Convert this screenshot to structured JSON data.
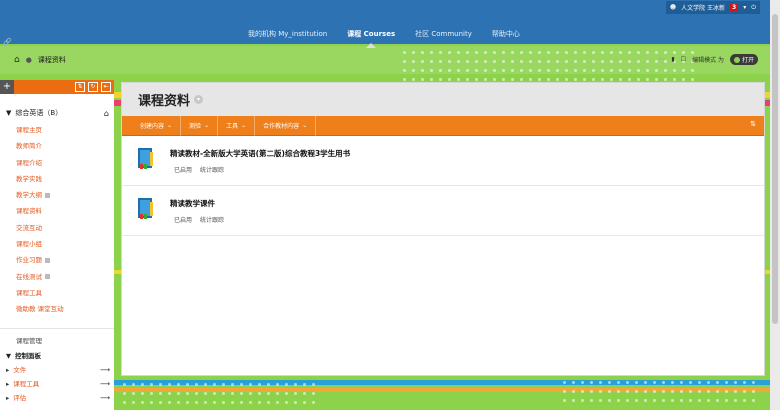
{
  "header": {
    "user_name": "人文学院 王冰新",
    "notification_count": "3",
    "nav": [
      {
        "label": "我的机构 My_institution"
      },
      {
        "label": "课程 Courses"
      },
      {
        "label": "社区 Community"
      },
      {
        "label": "帮助中心"
      }
    ]
  },
  "breadcrumb": {
    "current": "课程资料"
  },
  "edit_mode": {
    "label": "编辑模式 为",
    "state": "打开"
  },
  "sidebar": {
    "course_name": "综合英语（B）",
    "items": [
      {
        "label": "课程主页"
      },
      {
        "label": "教师简介"
      },
      {
        "label": "课程介绍"
      },
      {
        "label": "教学实践"
      },
      {
        "label": "教学大纲"
      },
      {
        "label": "课程资料"
      },
      {
        "label": "交流互动"
      },
      {
        "label": "课程小组"
      },
      {
        "label": "作业习题"
      },
      {
        "label": "在线测试"
      },
      {
        "label": "课程工具"
      },
      {
        "label": "微助教 课堂互动"
      }
    ],
    "management_title": "课程管理",
    "control_panel": "控制面板",
    "panel_items": [
      {
        "label": "文件"
      },
      {
        "label": "课程工具"
      },
      {
        "label": "评估"
      }
    ]
  },
  "content": {
    "title": "课程资料",
    "action_bar": [
      {
        "label": "创建内容"
      },
      {
        "label": "测验"
      },
      {
        "label": "工具"
      },
      {
        "label": "合作教材内容"
      }
    ],
    "items": [
      {
        "title": "精读教材-全新版大学英语(第二版)综合教程3学生用书",
        "status": "已启用",
        "tracking": "统计跟踪"
      },
      {
        "title": "精读教学课件",
        "status": "已启用",
        "tracking": "统计跟踪"
      }
    ]
  },
  "colors": {
    "header_blue": "#2d73b4",
    "accent_orange": "#ef7f1a",
    "background_green": "#8cd24a",
    "link_orange": "#e4561b"
  }
}
